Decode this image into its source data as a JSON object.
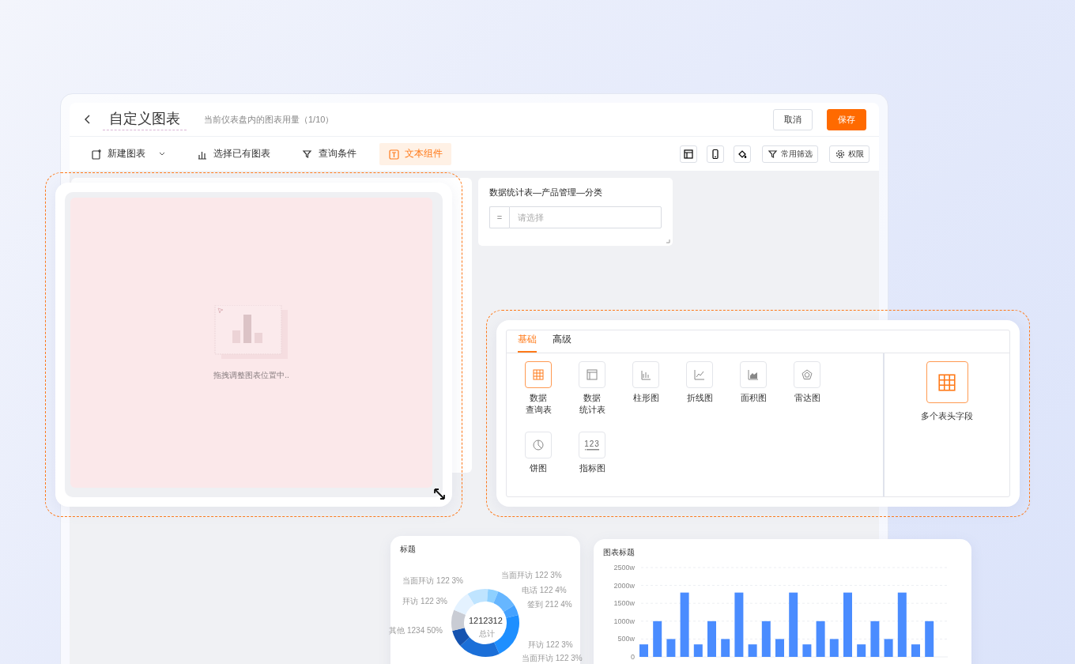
{
  "header": {
    "title": "自定义图表",
    "subtitle": "当前仪表盘内的图表用量（1/10）",
    "buttons": [
      {
        "label": "取消",
        "kind": "default"
      },
      {
        "label": "保存",
        "kind": "primary"
      }
    ]
  },
  "toolbar": {
    "items": [
      {
        "label": "新建图表",
        "dropdown": true,
        "selected": false
      },
      {
        "label": "选择已有图表",
        "dropdown": false,
        "selected": false
      },
      {
        "label": "查询条件",
        "dropdown": false,
        "selected": false
      },
      {
        "label": "文本组件",
        "dropdown": false,
        "selected": true
      }
    ],
    "buttons": [
      {
        "label": "常用筛选"
      },
      {
        "label": "权限"
      }
    ]
  },
  "filter_card": {
    "title": "数据统计表—产品管理—分类",
    "operator": "=",
    "placeholder": "请选择"
  },
  "drag_preview": {
    "text": "拖拽调整图表位置中.."
  },
  "chart_picker": {
    "tabs": [
      {
        "label": "基础",
        "selected": true
      },
      {
        "label": "高级",
        "selected": false
      }
    ],
    "items": [
      {
        "kind": "table",
        "lines": [
          "数据",
          "查询表"
        ],
        "selected": true
      },
      {
        "kind": "stat",
        "lines": [
          "数据",
          "统计表"
        ],
        "selected": false
      },
      {
        "kind": "bar",
        "lines": [
          "柱形图"
        ],
        "selected": false
      },
      {
        "kind": "line",
        "lines": [
          "折线图"
        ],
        "selected": false
      },
      {
        "kind": "area",
        "lines": [
          "面积图"
        ],
        "selected": false
      },
      {
        "kind": "radar",
        "lines": [
          "雷达图"
        ],
        "selected": false
      },
      {
        "kind": "pie",
        "lines": [
          "饼图"
        ],
        "selected": false
      },
      {
        "kind": "metric",
        "lines": [
          "指标图"
        ],
        "icon_text": "123",
        "selected": false
      }
    ],
    "side_item": {
      "kind": "table",
      "label": "多个表头字段",
      "selected": true
    }
  },
  "donut_card": {
    "title": "标题",
    "total": "1212312",
    "total_label": "总计",
    "labels": [
      "当面拜访 122 3%",
      "拜访 122 3%",
      "其他 1234 50%",
      "当面拜访 122 3%",
      "电话 122 4%",
      "签到 212 4%",
      "拜访 122 3%",
      "当面拜访 122 3%"
    ]
  },
  "bar_card": {
    "title": "图表标题",
    "chart_data": {
      "type": "bar",
      "grid": true,
      "ylim": [
        0,
        2500
      ],
      "yticks": [
        {
          "value": 0,
          "label": "0"
        },
        {
          "value": 500,
          "label": "500w"
        },
        {
          "value": 1000,
          "label": "1000w"
        },
        {
          "value": 1500,
          "label": "1500w"
        },
        {
          "value": 2000,
          "label": "2000w"
        },
        {
          "value": 2500,
          "label": "2500w"
        }
      ],
      "series": [
        {
          "color": "#4a8cff",
          "values": [
            350,
            1000,
            500,
            1800,
            350,
            1000,
            500,
            1800,
            350,
            1000,
            500,
            1800,
            350,
            1000,
            500,
            1800,
            350,
            1000,
            500,
            1800,
            350,
            1000
          ]
        }
      ]
    }
  }
}
